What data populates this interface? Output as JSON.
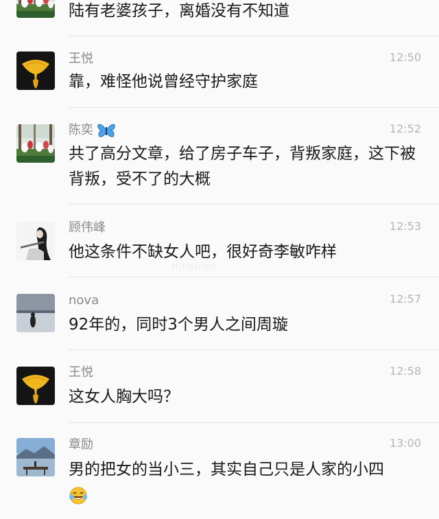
{
  "messages": [
    {
      "name": "",
      "time": "",
      "text": "陆有老婆孩子，离婚没有不知道",
      "avatar": "tulip-photo"
    },
    {
      "name": "王悦",
      "time": "12:50",
      "text": "靠，难怪他说曾经守护家庭",
      "avatar": "ginkgo-leaf-photo"
    },
    {
      "name": "陈奕",
      "time": "12:52",
      "text": "共了高分文章，给了房子车子，背叛家庭，这下被背叛，受不了的大概",
      "avatar": "tulip-photo",
      "name_emoji": "butterfly-icon"
    },
    {
      "name": "顾伟峰",
      "time": "12:53",
      "text": "他这条件不缺女人吧，很好奇李敏咋样",
      "avatar": "ink-figure-drawing"
    },
    {
      "name": "nova",
      "time": "12:57",
      "text": "92年的，同时3个男人之间周璇",
      "avatar": "seaside-silhouette-photo"
    },
    {
      "name": "王悦",
      "time": "12:58",
      "text": "这女人胸大吗？",
      "avatar": "ginkgo-leaf-photo"
    },
    {
      "name": "章励",
      "time": "13:00",
      "text": "男的把女的当小三，其实自己只是人家的小四",
      "avatar": "lake-pier-photo",
      "trailing_emoji": "laughing-tears-emoji"
    }
  ],
  "watermark": "Hinabian",
  "colors": {
    "background": "#fafafa",
    "name": "#8a8a8a",
    "time": "#b5b5b5",
    "text": "#1a1a1a",
    "divider": "#e4e4e4"
  }
}
